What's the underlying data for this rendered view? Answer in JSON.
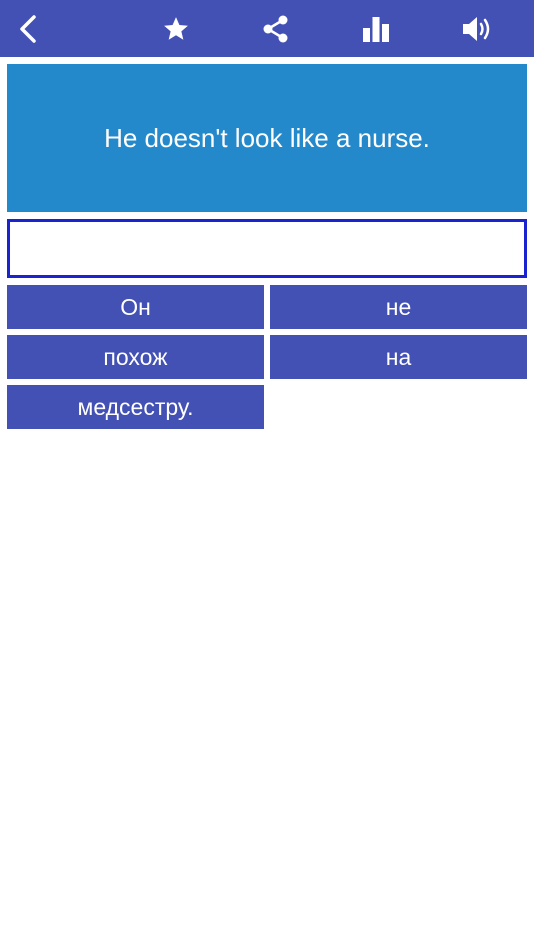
{
  "colors": {
    "toolbar_bg": "#4350b4",
    "prompt_bg": "#2489cb",
    "answer_border": "#1a23d0",
    "word_bg": "#4350b4",
    "text_on_color": "#ffffff"
  },
  "toolbar": {
    "icons": [
      "back-chevron-icon",
      "star-icon",
      "share-icon",
      "bar-chart-icon",
      "speaker-icon"
    ]
  },
  "prompt": {
    "text": "He doesn't look like a nurse."
  },
  "answer": {
    "value": ""
  },
  "words": [
    {
      "label": "Он"
    },
    {
      "label": "не"
    },
    {
      "label": "похож"
    },
    {
      "label": "на"
    },
    {
      "label": "медсестру."
    }
  ]
}
